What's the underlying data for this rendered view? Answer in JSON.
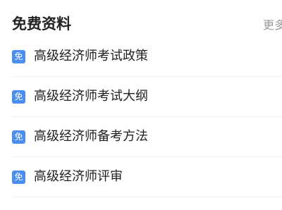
{
  "header": {
    "title": "免费资料",
    "more_label": "更多"
  },
  "colors": {
    "badge": "#4a8ef0",
    "title_text": "#222222",
    "more_text": "#999999",
    "divider": "#eeeeee"
  },
  "items": [
    {
      "badge": "免",
      "label": "高级经济师考试政策"
    },
    {
      "badge": "免",
      "label": "高级经济师考试大纲"
    },
    {
      "badge": "免",
      "label": "高级经济师备考方法"
    },
    {
      "badge": "免",
      "label": "高级经济师评审"
    }
  ]
}
